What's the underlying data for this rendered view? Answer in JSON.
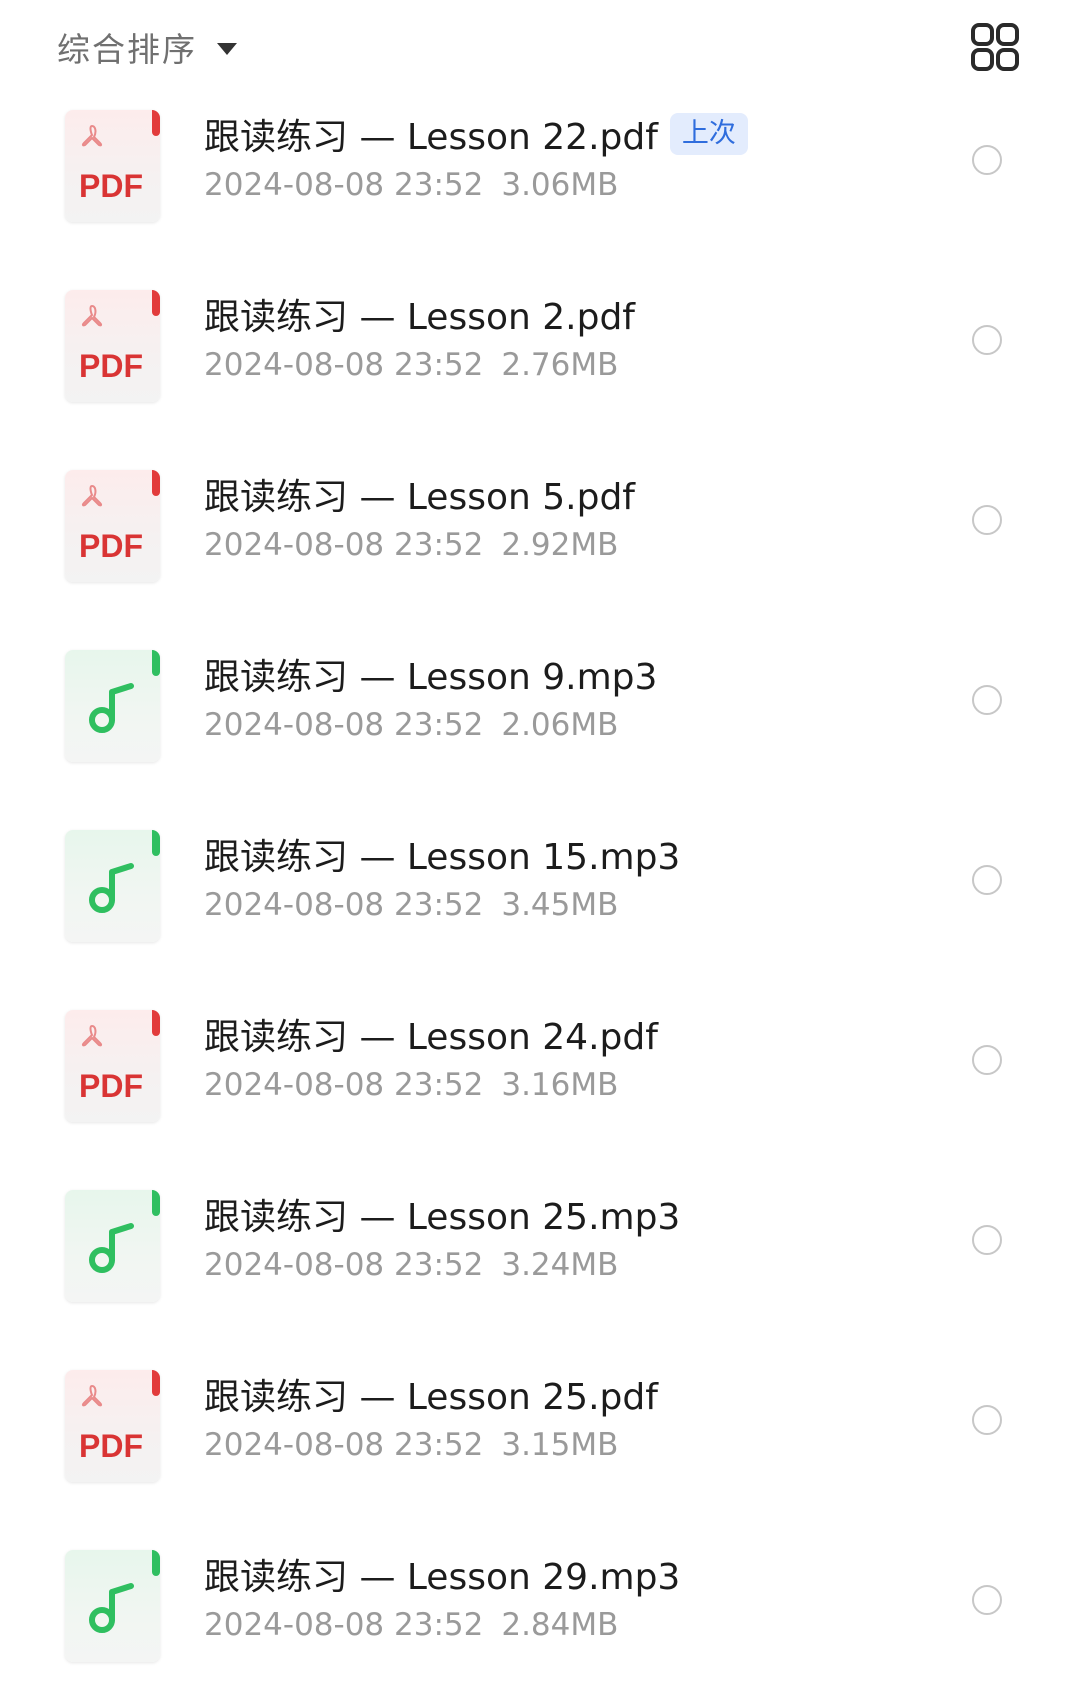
{
  "header": {
    "sort_label": "综合排序",
    "sort_icon": "caret-down-icon",
    "view_toggle_icon": "grid-view-icon"
  },
  "colors": {
    "pdf_accent": "#e23b3b",
    "mp3_accent": "#2fbf60",
    "badge_text": "#2f6ddd",
    "badge_bg": "#e3ecfd",
    "meta_text": "#9a9a9a"
  },
  "files": [
    {
      "name": "跟读练习 — Lesson 22.pdf",
      "type": "pdf",
      "thumb_label": "PDF",
      "date": "2024-08-08 23:52",
      "size": "3.06MB",
      "badge": "上次",
      "selected": false
    },
    {
      "name": "跟读练习 — Lesson 2.pdf",
      "type": "pdf",
      "thumb_label": "PDF",
      "date": "2024-08-08 23:52",
      "size": "2.76MB",
      "badge": null,
      "selected": false
    },
    {
      "name": "跟读练习 — Lesson 5.pdf",
      "type": "pdf",
      "thumb_label": "PDF",
      "date": "2024-08-08 23:52",
      "size": "2.92MB",
      "badge": null,
      "selected": false
    },
    {
      "name": "跟读练习 — Lesson 9.mp3",
      "type": "mp3",
      "thumb_label": null,
      "date": "2024-08-08 23:52",
      "size": "2.06MB",
      "badge": null,
      "selected": false
    },
    {
      "name": "跟读练习 — Lesson 15.mp3",
      "type": "mp3",
      "thumb_label": null,
      "date": "2024-08-08 23:52",
      "size": "3.45MB",
      "badge": null,
      "selected": false
    },
    {
      "name": "跟读练习 — Lesson 24.pdf",
      "type": "pdf",
      "thumb_label": "PDF",
      "date": "2024-08-08 23:52",
      "size": "3.16MB",
      "badge": null,
      "selected": false
    },
    {
      "name": "跟读练习 — Lesson 25.mp3",
      "type": "mp3",
      "thumb_label": null,
      "date": "2024-08-08 23:52",
      "size": "3.24MB",
      "badge": null,
      "selected": false
    },
    {
      "name": "跟读练习 — Lesson 25.pdf",
      "type": "pdf",
      "thumb_label": "PDF",
      "date": "2024-08-08 23:52",
      "size": "3.15MB",
      "badge": null,
      "selected": false
    },
    {
      "name": "跟读练习 — Lesson 29.mp3",
      "type": "mp3",
      "thumb_label": null,
      "date": "2024-08-08 23:52",
      "size": "2.84MB",
      "badge": null,
      "selected": false
    }
  ]
}
